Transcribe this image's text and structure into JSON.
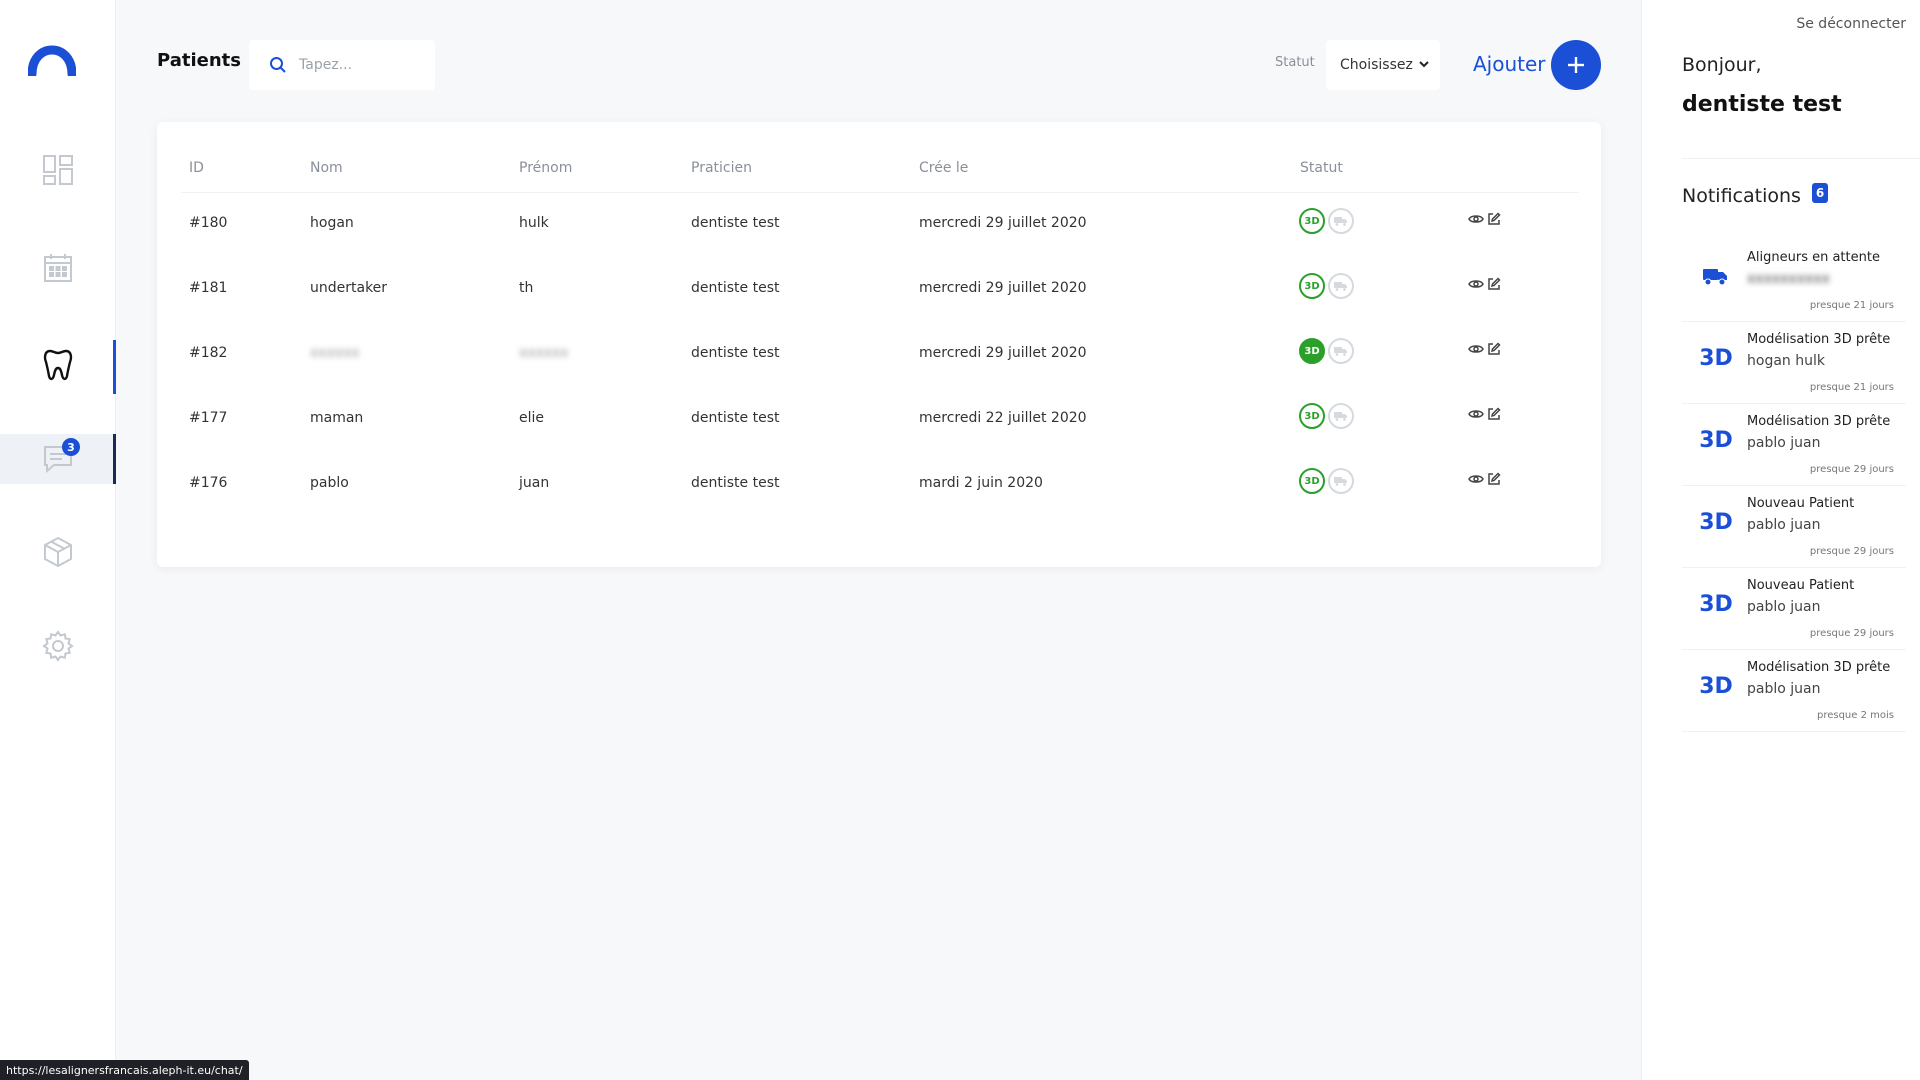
{
  "header": {
    "title": "Patients",
    "search_placeholder": "Tapez...",
    "status_label": "Statut",
    "status_select_value": "Choisissez",
    "add_label": "Ajouter"
  },
  "sidebar": {
    "messages_badge": "3"
  },
  "table": {
    "columns": [
      "ID",
      "Nom",
      "Prénom",
      "Praticien",
      "Crée le",
      "Statut"
    ],
    "rows": [
      {
        "id": "#180",
        "nom": "hogan",
        "prenom": "hulk",
        "praticien": "dentiste test",
        "cree": "mercredi 29 juillet 2020",
        "status_3d_filled": false
      },
      {
        "id": "#181",
        "nom": "undertaker",
        "prenom": "th",
        "praticien": "dentiste test",
        "cree": "mercredi 29 juillet 2020",
        "status_3d_filled": false
      },
      {
        "id": "#182",
        "nom": "xxxxxx",
        "prenom": "xxxxxx",
        "praticien": "dentiste test",
        "cree": "mercredi 29 juillet 2020",
        "status_3d_filled": true
      },
      {
        "id": "#177",
        "nom": "maman",
        "prenom": "elie",
        "praticien": "dentiste test",
        "cree": "mercredi 22 juillet 2020",
        "status_3d_filled": false
      },
      {
        "id": "#176",
        "nom": "pablo",
        "prenom": "juan",
        "praticien": "dentiste test",
        "cree": "mardi 2 juin 2020",
        "status_3d_filled": false
      }
    ],
    "status_3d_label": "3D"
  },
  "right_panel": {
    "logout": "Se déconnecter",
    "greeting": "Bonjour,",
    "username": "dentiste test",
    "notifications_title": "Notifications",
    "notifications_count": "6",
    "notifications": [
      {
        "icon": "truck-icon",
        "title": "Aligneurs en attente",
        "subtitle": "xxxxxxxxxx",
        "time": "presque 21 jours"
      },
      {
        "icon": "3d-icon",
        "title": "Modélisation 3D prête",
        "subtitle": "hogan hulk",
        "time": "presque 21 jours"
      },
      {
        "icon": "3d-icon",
        "title": "Modélisation 3D prête",
        "subtitle": "pablo juan",
        "time": "presque 29 jours"
      },
      {
        "icon": "3d-icon",
        "title": "Nouveau Patient",
        "subtitle": "pablo juan",
        "time": "presque 29 jours"
      },
      {
        "icon": "3d-icon",
        "title": "Nouveau Patient",
        "subtitle": "pablo juan",
        "time": "presque 29 jours"
      },
      {
        "icon": "3d-icon",
        "title": "Modélisation 3D prête",
        "subtitle": "pablo juan",
        "time": "presque 2 mois"
      }
    ],
    "icon_3d_text": "3D"
  },
  "statusbar_url": "https://lesalignersfrancais.aleph-it.eu/chat/",
  "colors": {
    "accent": "#1a4fd6",
    "success": "#2aa02a"
  }
}
